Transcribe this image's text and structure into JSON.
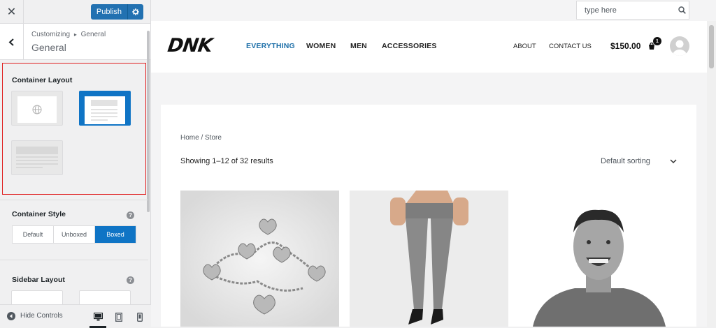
{
  "sidebar": {
    "close_label": "✕",
    "publish_label": "Publish",
    "breadcrumb": {
      "root": "Customizing",
      "separator": "▸",
      "current": "General"
    },
    "title": "General",
    "container_layout": {
      "label": "Container Layout",
      "selected_index": 1
    },
    "container_style": {
      "label": "Container Style",
      "help": "?",
      "options": [
        "Default",
        "Unboxed",
        "Boxed"
      ],
      "selected": "Boxed"
    },
    "sidebar_layout": {
      "label": "Sidebar Layout",
      "help": "?"
    },
    "footer": {
      "hide_controls": "Hide Controls",
      "active_device": "desktop"
    }
  },
  "preview": {
    "search": {
      "placeholder": "type here"
    },
    "logo": "DNK",
    "nav": {
      "main": [
        "EVERYTHING",
        "WOMEN",
        "MEN",
        "ACCESSORIES"
      ],
      "active": "EVERYTHING",
      "secondary": [
        "ABOUT",
        "CONTACT US"
      ]
    },
    "cart": {
      "total": "$150.00",
      "count": "1"
    },
    "shop": {
      "breadcrumb": "Home / Store",
      "results": "Showing 1–12 of 32 results",
      "sorting": "Default sorting"
    },
    "products": [
      {
        "image": "heart-charm-bracelet"
      },
      {
        "image": "grey-jeans-heels"
      },
      {
        "image": "laughing-man-portrait"
      }
    ]
  },
  "colors": {
    "accent": "#2271b1",
    "selected_blue": "#0f74c5",
    "nav_active": "#1d6fa8",
    "highlight": "#e02020"
  }
}
